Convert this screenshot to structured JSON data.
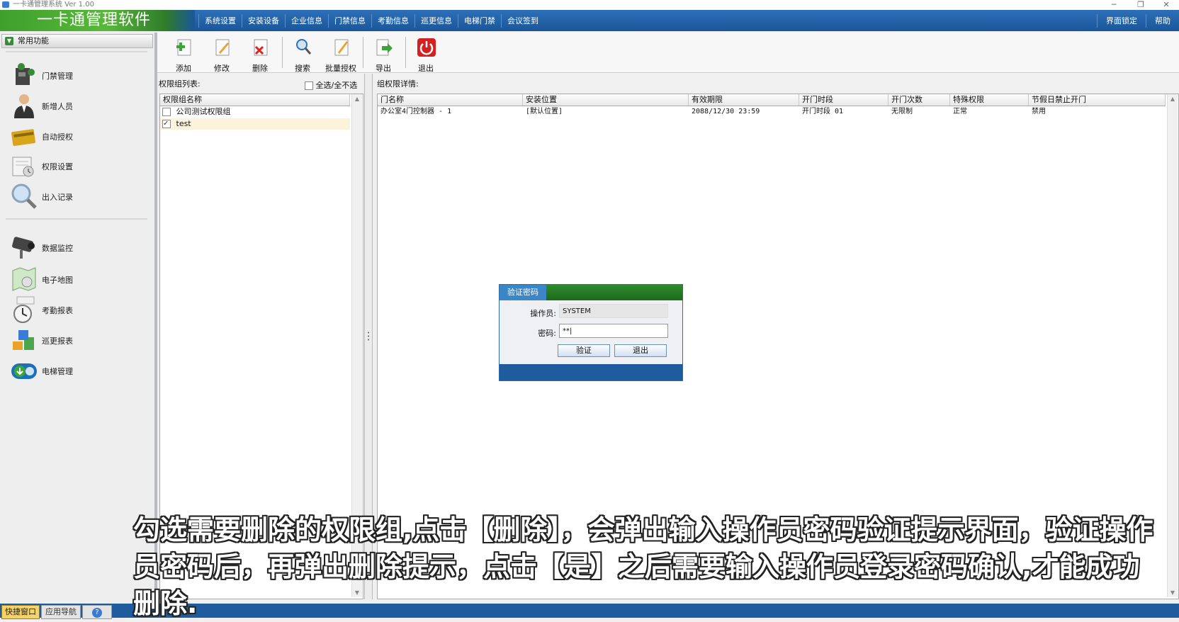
{
  "window": {
    "title": "一卡通管理系统  Ver 1.00",
    "controls": [
      "─",
      "❐",
      "✕"
    ]
  },
  "menubar": {
    "app_title": "一卡通管理软件",
    "items": [
      "系统设置",
      "安装设备",
      "企业信息",
      "门禁信息",
      "考勤信息",
      "巡更信息",
      "电梯门禁",
      "会议签到"
    ],
    "right_items": [
      "界面锁定",
      "帮助"
    ]
  },
  "sidebar": {
    "header": "常用功能",
    "items": [
      {
        "label": "门禁管理",
        "icon": "door-access-icon"
      },
      {
        "label": "新增人员",
        "icon": "person-icon"
      },
      {
        "label": "自动授权",
        "icon": "card-icon"
      },
      {
        "label": "权限设置",
        "icon": "permission-icon"
      },
      {
        "label": "出入记录",
        "icon": "magnifier-icon"
      },
      {
        "label": "数据监控",
        "icon": "camera-icon"
      },
      {
        "label": "电子地图",
        "icon": "map-icon"
      },
      {
        "label": "考勤报表",
        "icon": "clock-icon"
      },
      {
        "label": "巡更报表",
        "icon": "patrol-icon"
      },
      {
        "label": "电梯管理",
        "icon": "elevator-icon"
      }
    ]
  },
  "toolbar": {
    "buttons": [
      {
        "label": "添加",
        "icon": "add-icon"
      },
      {
        "label": "修改",
        "icon": "edit-icon"
      },
      {
        "label": "删除",
        "icon": "delete-icon"
      },
      {
        "label": "搜索",
        "icon": "search-icon"
      },
      {
        "label": "批量授权",
        "icon": "batch-authorize-icon"
      },
      {
        "label": "导出",
        "icon": "export-icon"
      },
      {
        "label": "退出",
        "icon": "power-icon"
      }
    ]
  },
  "left_panel": {
    "title": "权限组列表:",
    "select_all_label": "全选/全不选",
    "column_header": "权限组名称",
    "rows": [
      {
        "name": "公司测试权限组",
        "checked": false
      },
      {
        "name": "test",
        "checked": true
      }
    ]
  },
  "right_panel": {
    "title": "组权限详情:",
    "columns": [
      "门名称",
      "安装位置",
      "有效期限",
      "开门时段",
      "开门次数",
      "特殊权限",
      "节假日禁止开门"
    ],
    "rows": [
      [
        "办公室4门控制器 - 1",
        "[默认位置]",
        "2088/12/30 23:59",
        "开门时段 01",
        "无限制",
        "正常",
        "禁用"
      ]
    ]
  },
  "dialog": {
    "title": "验证密码",
    "operator_label": "操作员:",
    "operator_value": "SYSTEM",
    "password_label": "密码:",
    "password_value": "**|",
    "verify_button": "验证",
    "cancel_button": "退出"
  },
  "bottombar": {
    "tabs": [
      "快捷窗口",
      "应用导航"
    ],
    "help_icon": "?"
  },
  "caption": {
    "text": "勾选需要删除的权限组,点击【删除】，会弹出输入操作员密码验证提示界面，验证操作员密码后，再弹出删除提示，点击【是】之后需要输入操作员登录密码确认,才能成功删除."
  },
  "colors": {
    "menubar_blue": "#1a5699",
    "title_green": "#3fa02b",
    "dialog_green": "#2e8c2e",
    "active_tab_yellow": "#f4d46a"
  }
}
